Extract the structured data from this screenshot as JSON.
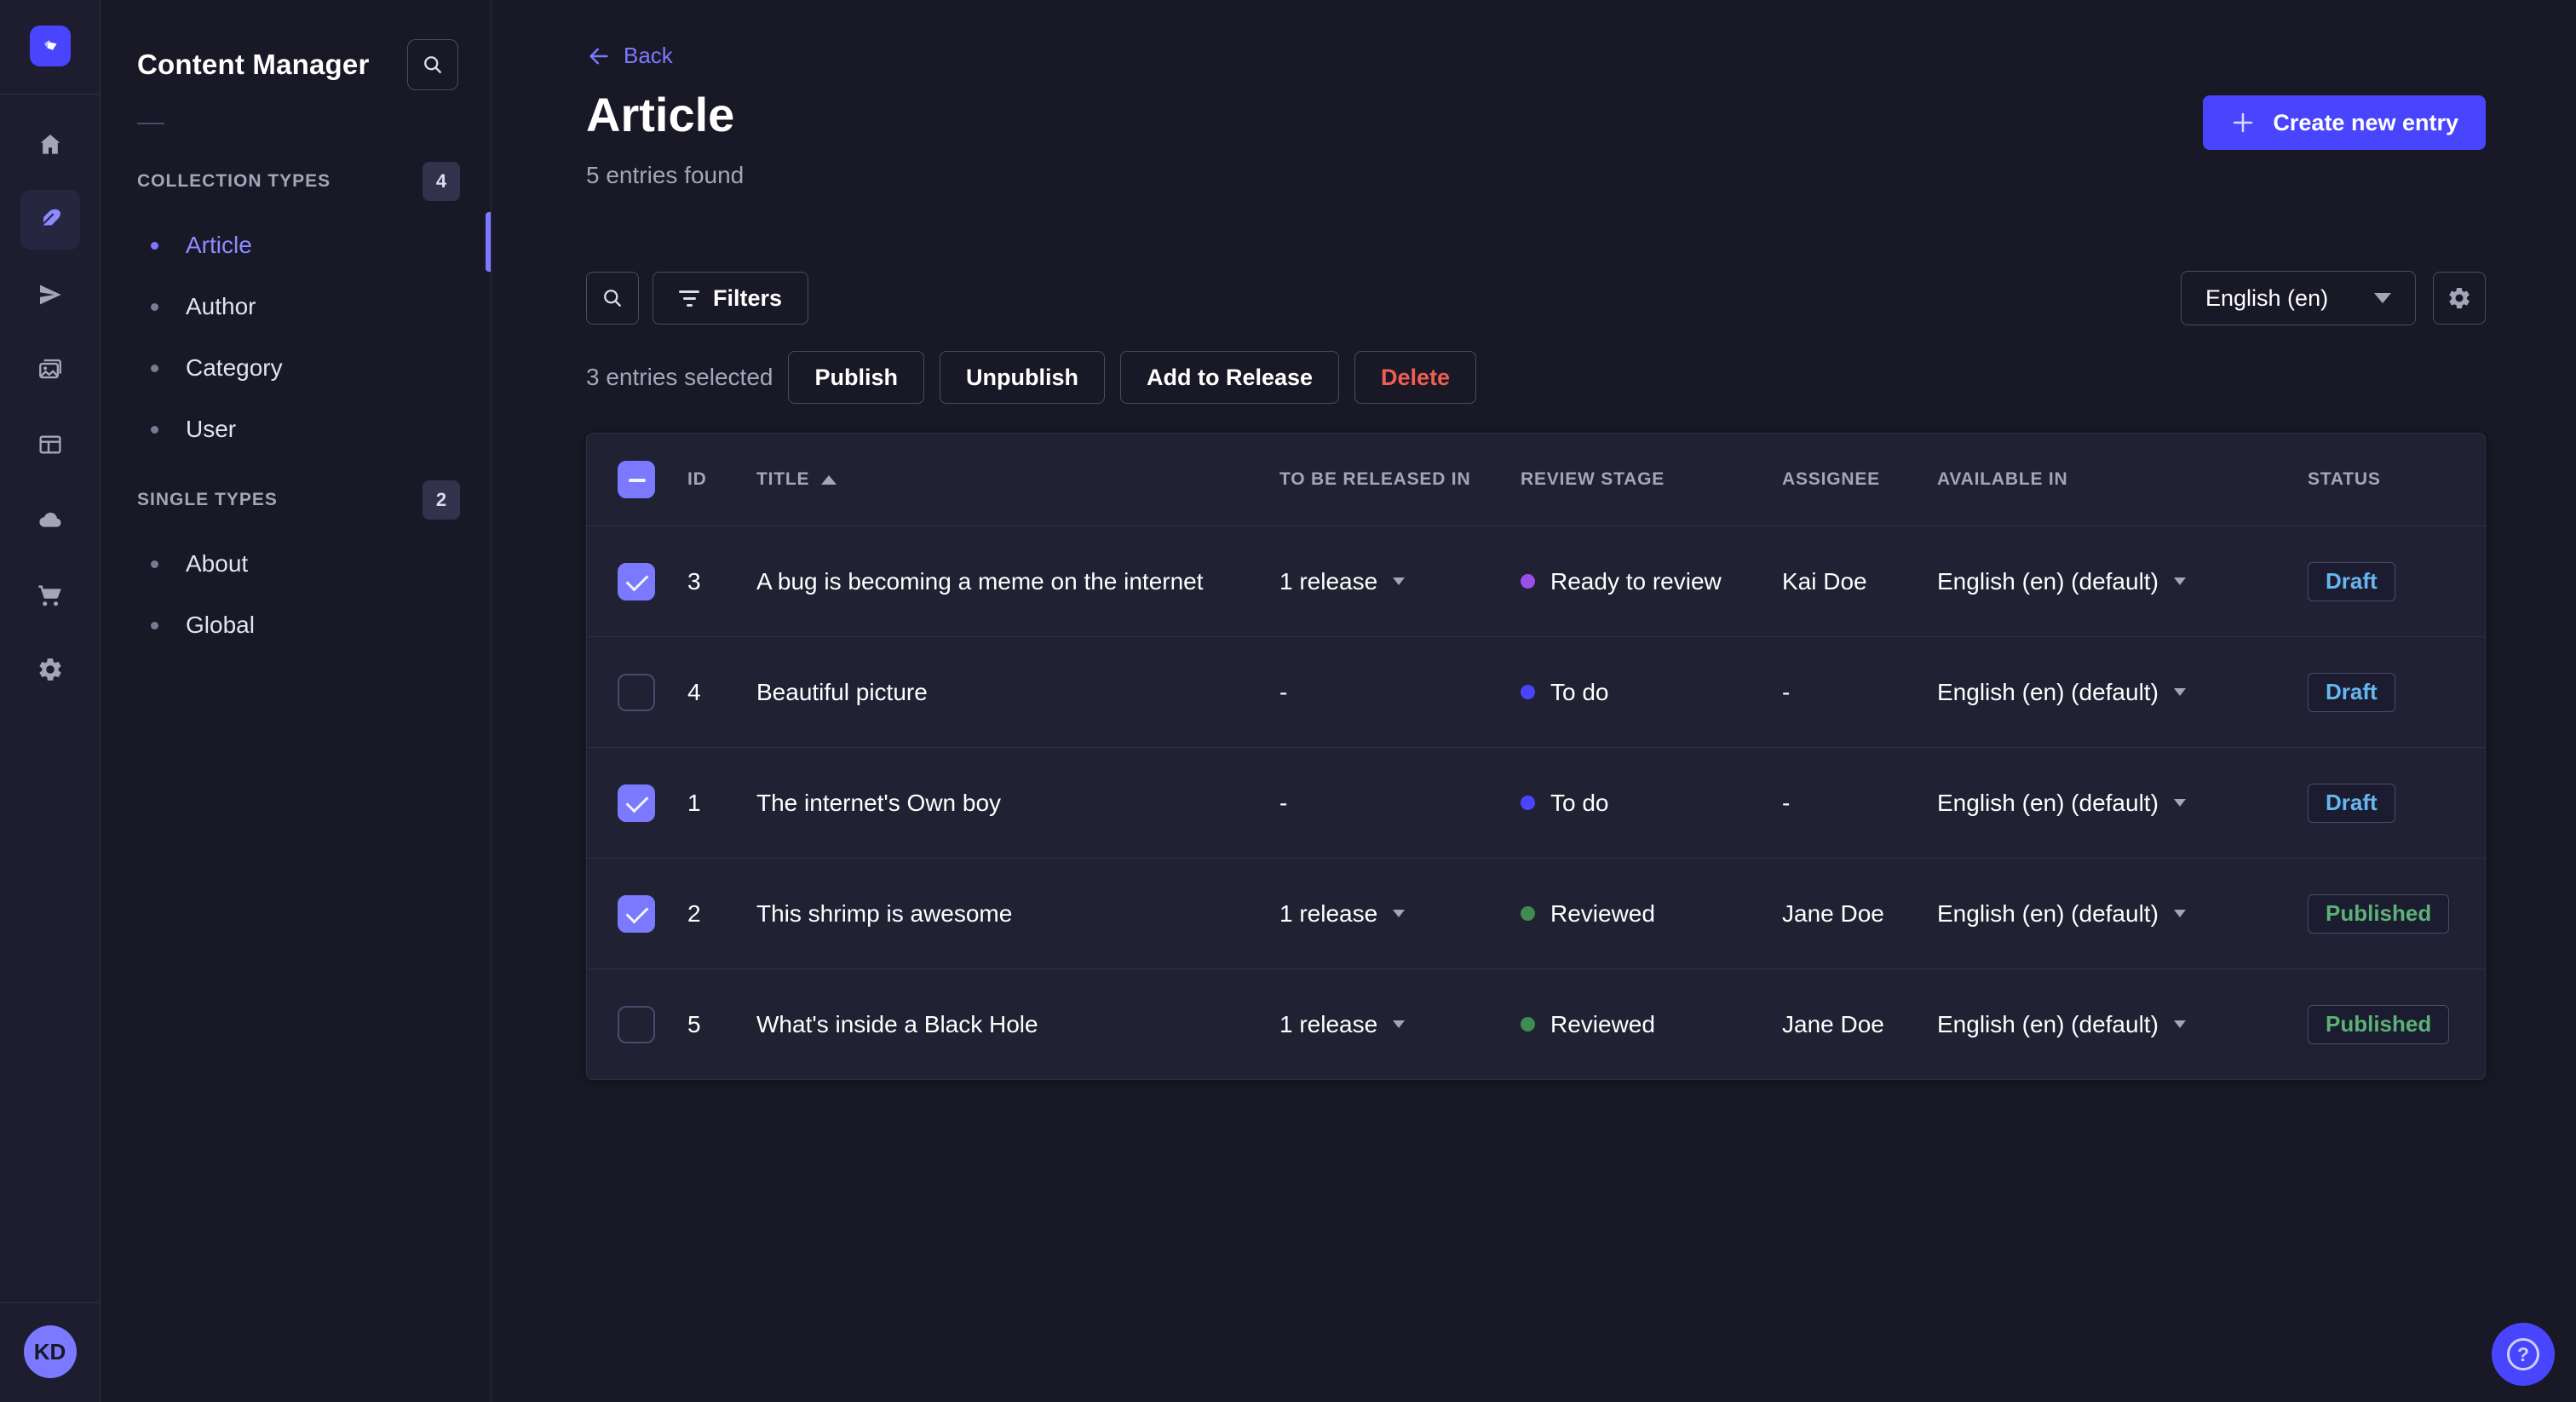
{
  "colors": {
    "accent": "#4945ff",
    "accent_light": "#7b79ff",
    "draft": "#66b7f1",
    "published": "#5cb176",
    "danger": "#ee5e52",
    "todo_dot": "#4945ff",
    "ready_dot": "#9c4fe8",
    "reviewed_dot": "#3f8b52"
  },
  "rail": {
    "logo_icon": "strapi-logo",
    "items": [
      "home-icon",
      "content-manager-feather-icon",
      "releases-send-icon",
      "media-library-icon",
      "content-type-builder-icon",
      "deploy-cloud-icon",
      "marketplace-cart-icon",
      "settings-gear-icon"
    ],
    "active_item": "content-manager-feather-icon",
    "avatar_initials": "KD"
  },
  "subnav": {
    "title": "Content Manager",
    "search_icon": "search-icon",
    "sections": [
      {
        "label": "COLLECTION TYPES",
        "badge": "4",
        "items": [
          {
            "label": "Article",
            "active": true
          },
          {
            "label": "Author",
            "active": false
          },
          {
            "label": "Category",
            "active": false
          },
          {
            "label": "User",
            "active": false
          }
        ]
      },
      {
        "label": "SINGLE TYPES",
        "badge": "2",
        "items": [
          {
            "label": "About",
            "active": false
          },
          {
            "label": "Global",
            "active": false
          }
        ]
      }
    ]
  },
  "header": {
    "back_label": "Back",
    "title": "Article",
    "subtitle": "5 entries found",
    "create_button": "Create new entry"
  },
  "toolbar": {
    "filters_label": "Filters",
    "locale_value": "English (en)"
  },
  "selection": {
    "count_label": "3 entries selected",
    "actions": [
      {
        "label": "Publish",
        "variant": "default"
      },
      {
        "label": "Unpublish",
        "variant": "default"
      },
      {
        "label": "Add to Release",
        "variant": "default"
      },
      {
        "label": "Delete",
        "variant": "danger"
      }
    ]
  },
  "table": {
    "columns": [
      "ID",
      "TITLE",
      "TO BE RELEASED IN",
      "REVIEW STAGE",
      "ASSIGNEE",
      "AVAILABLE IN",
      "STATUS"
    ],
    "sorted_column": "TITLE",
    "sort_direction": "ascending",
    "rows": [
      {
        "selected": true,
        "id": "3",
        "title": "A bug is becoming a meme on the internet",
        "to_be_released_in": "1 release",
        "review_stage": "Ready to review",
        "stage_color": "#9c4fe8",
        "assignee": "Kai Doe",
        "available_in": "English (en) (default)",
        "status": "Draft"
      },
      {
        "selected": false,
        "id": "4",
        "title": "Beautiful picture",
        "to_be_released_in": "-",
        "review_stage": "To do",
        "stage_color": "#4945ff",
        "assignee": "-",
        "available_in": "English (en) (default)",
        "status": "Draft"
      },
      {
        "selected": true,
        "id": "1",
        "title": "The internet's Own boy",
        "to_be_released_in": "-",
        "review_stage": "To do",
        "stage_color": "#4945ff",
        "assignee": "-",
        "available_in": "English (en) (default)",
        "status": "Draft"
      },
      {
        "selected": true,
        "id": "2",
        "title": "This shrimp is awesome",
        "to_be_released_in": "1 release",
        "review_stage": "Reviewed",
        "stage_color": "#3f8b52",
        "assignee": "Jane Doe",
        "available_in": "English (en) (default)",
        "status": "Published"
      },
      {
        "selected": false,
        "id": "5",
        "title": "What's inside a Black Hole",
        "to_be_released_in": "1 release",
        "review_stage": "Reviewed",
        "stage_color": "#3f8b52",
        "assignee": "Jane Doe",
        "available_in": "English (en) (default)",
        "status": "Published"
      }
    ]
  },
  "help": {
    "icon_label": "?"
  }
}
